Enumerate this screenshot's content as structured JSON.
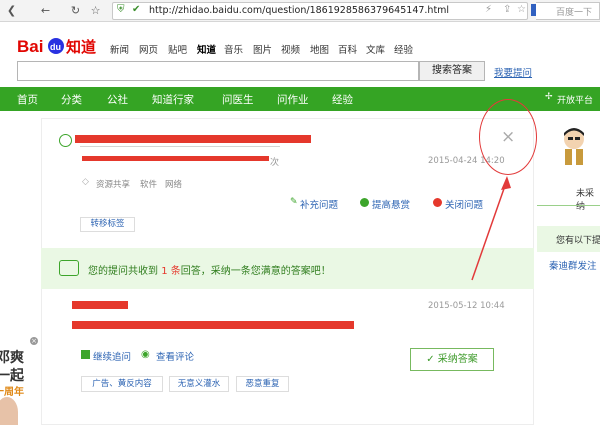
{
  "browser": {
    "url": "http://zhidao.baidu.com/question/1861928586379645147.html",
    "search_placeholder": "百度一下"
  },
  "header": {
    "logo_text": "Bai du 知道",
    "nav": [
      "新闻",
      "网页",
      "贴吧",
      "知道",
      "音乐",
      "图片",
      "视频",
      "地图",
      "百科",
      "文库",
      "经验"
    ],
    "search_button": "搜索答案",
    "ask_link": "我要提问"
  },
  "green_nav": {
    "items": [
      "首页",
      "分类",
      "公社",
      "知道行家",
      "问医生",
      "问作业",
      "经验"
    ],
    "open_platform": "开放平台"
  },
  "question": {
    "views_suffix": "次",
    "date": "2015-04-24 14:20",
    "tags": [
      "资源共享",
      "软件",
      "网络"
    ],
    "actions": [
      "补充问题",
      "提高悬赏",
      "关闭问题"
    ],
    "move_tag": "转移标签",
    "close_glyph": "×"
  },
  "notice": {
    "prefix": "您的提问共收到",
    "count": "1 条",
    "suffix": "回答，采纳一条您满意的答案吧！"
  },
  "answer": {
    "date": "2015-05-12 10:44",
    "continue_ask": "继续追问",
    "view_comments": "查看评论",
    "accept": "采纳答案",
    "report_buttons": [
      "广告、黄反内容",
      "无意义灌水",
      "恶意重复"
    ]
  },
  "sidebar": {
    "unadopted": "未采纳",
    "pending": "您有以下提",
    "user": "秦迪群发注"
  },
  "left_ad": {
    "line1": "邓爽",
    "line2": "一起",
    "line3": "十周年"
  },
  "colors": {
    "green": "#35a424",
    "link": "#2d64b3",
    "redact": "#e5382c"
  }
}
